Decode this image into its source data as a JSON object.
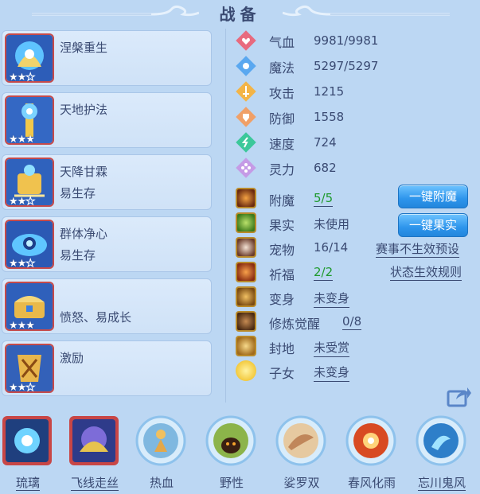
{
  "header": {
    "title": "战备"
  },
  "skills": [
    {
      "name": "涅槃重生",
      "desc": "",
      "stars_filled": 2,
      "stars_total": 3
    },
    {
      "name": "天地护法",
      "desc": "",
      "stars_filled": 3,
      "stars_total": 3
    },
    {
      "name": "天降甘霖",
      "desc": "易生存",
      "stars_filled": 2,
      "stars_total": 3
    },
    {
      "name": "群体净心",
      "desc": "易生存",
      "stars_filled": 2,
      "stars_total": 3
    },
    {
      "name": "",
      "desc": "愤怒、易成长",
      "stars_filled": 3,
      "stars_total": 3
    },
    {
      "name": "激励",
      "desc": "",
      "stars_filled": 2,
      "stars_total": 3
    }
  ],
  "stats": [
    {
      "label": "气血",
      "value": "9981/9981",
      "icon": "heart-icon",
      "color": "#e86a7e"
    },
    {
      "label": "魔法",
      "value": "5297/5297",
      "icon": "mana-icon",
      "color": "#5aa8f0"
    },
    {
      "label": "攻击",
      "value": "1215",
      "icon": "sword-icon",
      "color": "#f3b447"
    },
    {
      "label": "防御",
      "value": "1558",
      "icon": "shield-icon",
      "color": "#f0a068"
    },
    {
      "label": "速度",
      "value": "724",
      "icon": "speed-icon",
      "color": "#3cc89a"
    },
    {
      "label": "灵力",
      "value": "682",
      "icon": "spirit-icon",
      "color": "#c59be6"
    }
  ],
  "attrs": {
    "enchant": {
      "label": "附魔",
      "value": "5/5"
    },
    "fruit": {
      "label": "果实",
      "value": "未使用"
    },
    "pet": {
      "label": "宠物",
      "value": "16/14"
    },
    "bless": {
      "label": "祈福",
      "value": "2/2"
    },
    "transform": {
      "label": "变身",
      "value": "未变身"
    },
    "awaken": {
      "label": "修炼觉醒",
      "value": "0/8"
    },
    "fief": {
      "label": "封地",
      "value": "未受赏"
    },
    "child": {
      "label": "子女",
      "value": "未变身"
    }
  },
  "buttons": {
    "enchant_all": "一键附魔",
    "fruit_all": "一键果实"
  },
  "links": {
    "preset": "赛事不生效预设",
    "rules": "状态生效规则"
  },
  "bottom_items": [
    {
      "label": "琉璃",
      "underline": true
    },
    {
      "label": "飞线走丝",
      "underline": true
    },
    {
      "label": "热血",
      "underline": false
    },
    {
      "label": "野性",
      "underline": false
    },
    {
      "label": "娑罗双",
      "underline": false
    },
    {
      "label": "春风化雨",
      "underline": false
    },
    {
      "label": "忘川鬼风",
      "underline": true
    }
  ],
  "colors": {
    "background": "#bcd7f3",
    "text": "#3a4a72",
    "green": "#1f9a2e",
    "button": "#2e95ec",
    "frame_red": "#c64a4a"
  }
}
